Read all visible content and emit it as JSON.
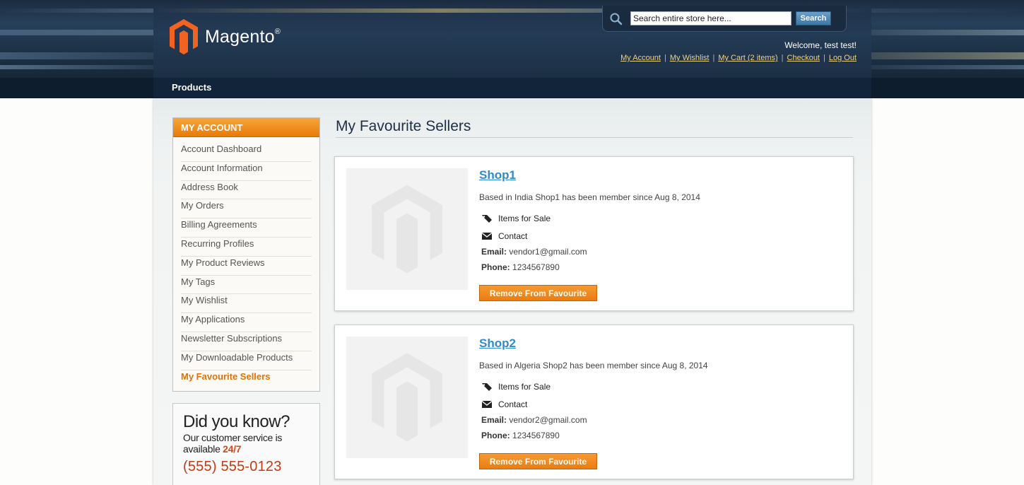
{
  "brand": {
    "name": "Magento",
    "mark": "®",
    "primary_color": "#e9790b",
    "link_color": "#2f8bc9",
    "header_color": "#1f324a"
  },
  "header": {
    "search": {
      "placeholder": "Search entire store here...",
      "button_label": "Search"
    },
    "welcome": "Welcome, test test!",
    "links": [
      "My Account",
      "My Wishlist",
      "My Cart (2 items)",
      "Checkout",
      "Log Out"
    ]
  },
  "nav": {
    "items": [
      "Products"
    ]
  },
  "sidebar": {
    "title": "MY ACCOUNT",
    "items": [
      {
        "label": "Account Dashboard",
        "active": false
      },
      {
        "label": "Account Information",
        "active": false
      },
      {
        "label": "Address Book",
        "active": false
      },
      {
        "label": "My Orders",
        "active": false
      },
      {
        "label": "Billing Agreements",
        "active": false
      },
      {
        "label": "Recurring Profiles",
        "active": false
      },
      {
        "label": "My Product Reviews",
        "active": false
      },
      {
        "label": "My Tags",
        "active": false
      },
      {
        "label": "My Wishlist",
        "active": false
      },
      {
        "label": "My Applications",
        "active": false
      },
      {
        "label": "Newsletter Subscriptions",
        "active": false
      },
      {
        "label": "My Downloadable Products",
        "active": false
      },
      {
        "label": "My Favourite Sellers",
        "active": true
      }
    ],
    "promo": {
      "title": "Did you know?",
      "line1": "Our customer service is",
      "line2_prefix": "available",
      "line2_highlight": "24/7",
      "phone": "(555) 555-0123"
    }
  },
  "main": {
    "title": "My Favourite Sellers",
    "sellers": [
      {
        "name": "Shop1",
        "description": "Based in India Shop1 has been member since Aug 8, 2014",
        "items_label": "Items for Sale",
        "contact_label": "Contact",
        "email_label": "Email:",
        "email": "vendor1@gmail.com",
        "phone_label": "Phone:",
        "phone": "1234567890",
        "remove_label": "Remove From Favourite"
      },
      {
        "name": "Shop2",
        "description": "Based in Algeria Shop2 has been member since Aug 8, 2014",
        "items_label": "Items for Sale",
        "contact_label": "Contact",
        "email_label": "Email:",
        "email": "vendor2@gmail.com",
        "phone_label": "Phone:",
        "phone": "1234567890",
        "remove_label": "Remove From Favourite"
      }
    ]
  },
  "icons": {
    "logo": "magento-logo-icon",
    "search": "search-icon",
    "tag": "tag-icon",
    "envelope": "envelope-icon",
    "placeholder": "magento-placeholder-icon"
  }
}
